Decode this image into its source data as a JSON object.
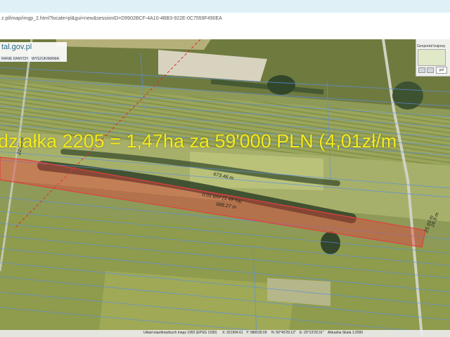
{
  "browser": {
    "url": "z.pl/imap/imgp_2.html?locale=pl&gui=new&sessionID=D9902BCF-4A10-4BB3-922E-0C7559F490EA"
  },
  "app": {
    "logo": "tal.gov.pl",
    "nav_tabs": [
      "RANIE DANYCH",
      "WYSZUKIWANIA"
    ]
  },
  "overlay": {
    "headline": "działka 2205 = 1,47ha za 59'000 PLN (4,01zł/m",
    "measurements": {
      "left_edge": "22.68 m",
      "top_edge": "673.46 m",
      "area": "0.01 km² (1.49 ha)",
      "bottom_edge": "688.27 m",
      "right_edge_1": "26.9 m",
      "right_edge_2": "25.99 m"
    }
  },
  "corner_widget": {
    "title": "Geoportal krajowy",
    "select_value": "pol"
  },
  "status_bar": {
    "crs": "Układ współrzędnych mapy 1992 (EPSG 2180)",
    "x": "X: 321994.61",
    "y": "Y: 586539.09",
    "lon": "N: 50°40'29.12''",
    "lat": "E: 20°13'29.31''",
    "scale": "Aktualna Skala 1:2000"
  }
}
